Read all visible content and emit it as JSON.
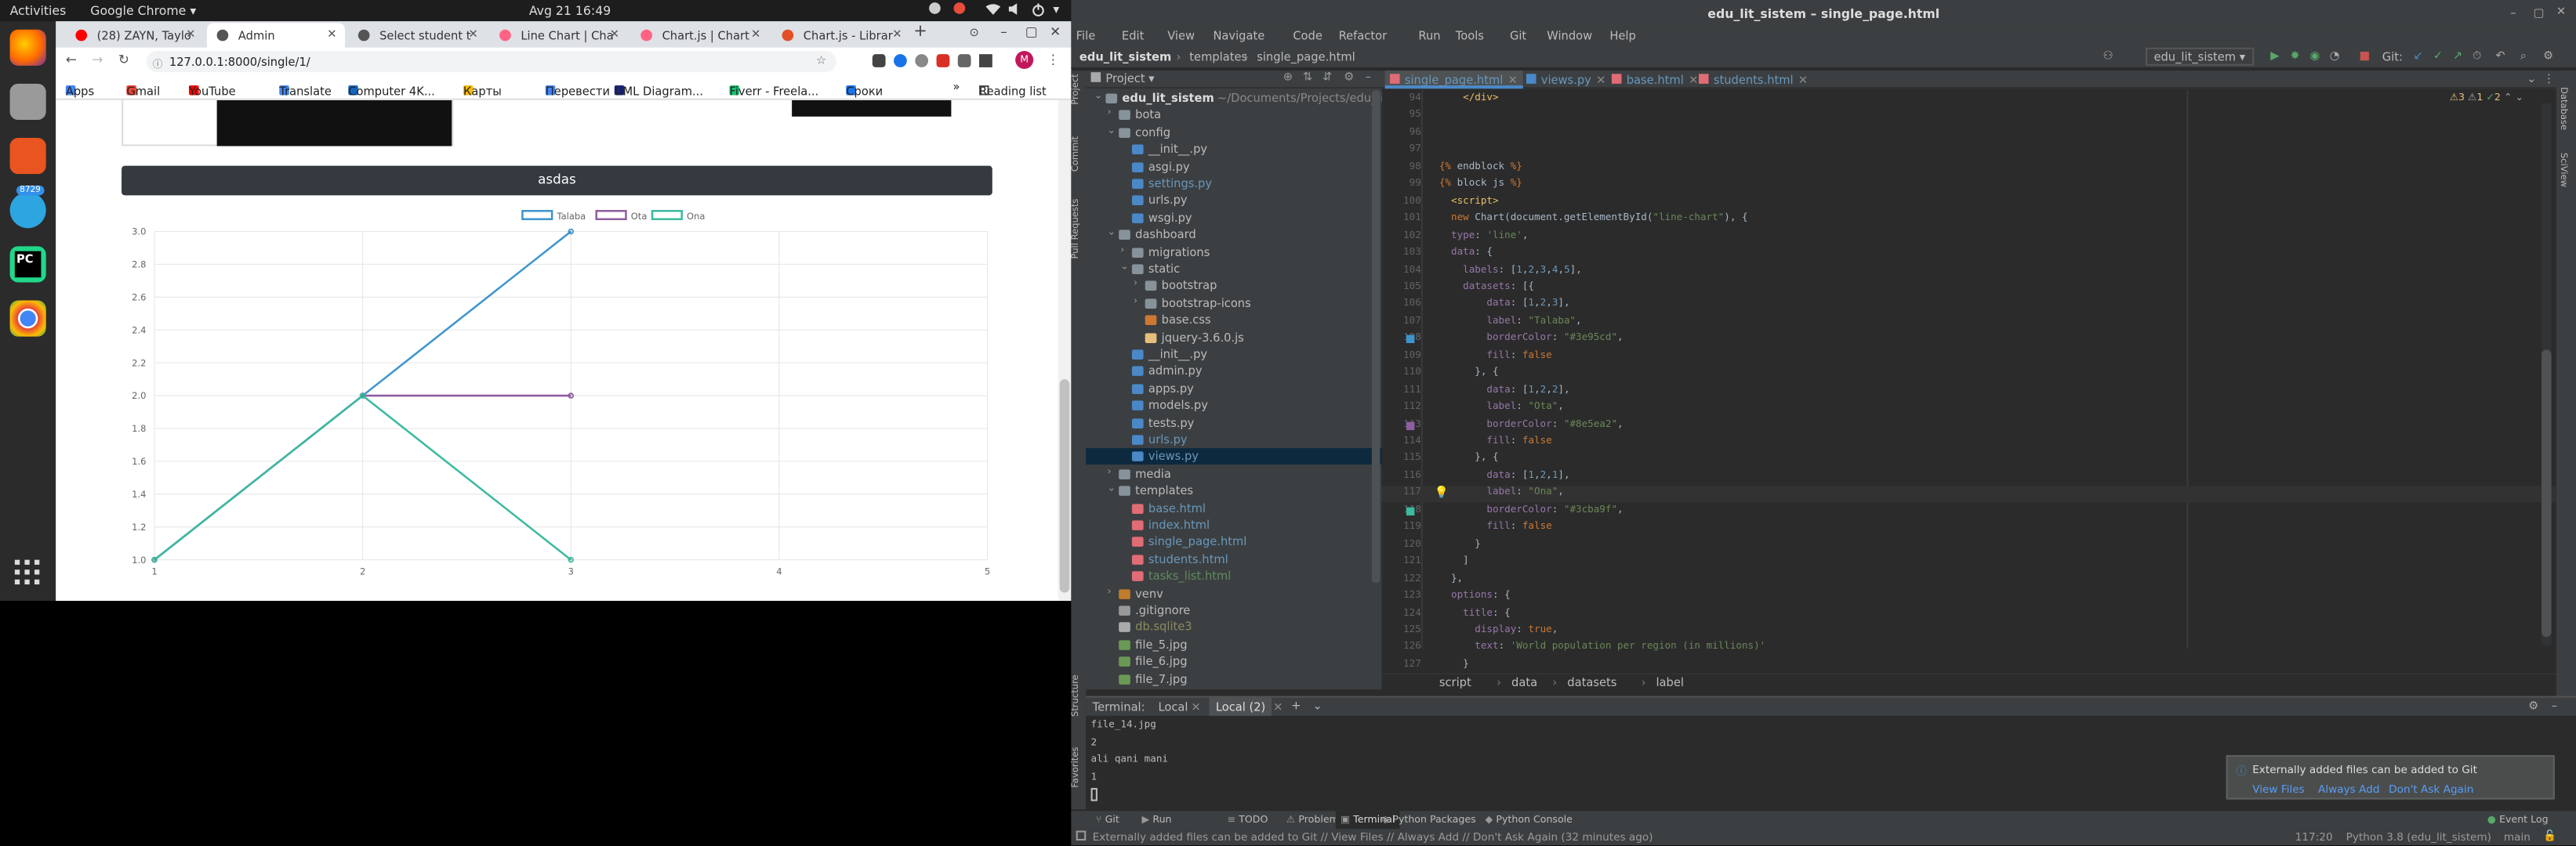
{
  "ubuntu": {
    "activities": "Activities",
    "app_name": "Google Chrome ▾",
    "clock": "Avg 21  16:49",
    "telegram_badge": "8729"
  },
  "chrome": {
    "tabs": [
      {
        "label": "(28) ZAYN, Taylo",
        "color": "#ff0000",
        "active": false
      },
      {
        "label": "Admin",
        "color": "#555555",
        "active": true
      },
      {
        "label": "Select student t",
        "color": "#555555",
        "active": false
      },
      {
        "label": "Line Chart | Cha",
        "color": "#ff6384",
        "active": false
      },
      {
        "label": "Chart.js | Chart",
        "color": "#ff6384",
        "active": false
      },
      {
        "label": "Chart.js - Librar",
        "color": "#e34f26",
        "active": false
      }
    ],
    "new_tab": "+",
    "url": "127.0.0.1:8000/single/1/",
    "profile_initial": "M",
    "bookmarks": [
      "Apps",
      "Gmail",
      "YouTube",
      "Translate",
      "Computer 4K...",
      "Карты",
      "Перевести",
      "UML Diagram...",
      "Fiverr - Freela...",
      "Сроки"
    ],
    "bookmarks_more": "»",
    "reading_list": "Reading list"
  },
  "page": {
    "header_label": "asdas",
    "chart_data": {
      "type": "line",
      "x": [
        1,
        2,
        3,
        4,
        5
      ],
      "ylim": [
        1.0,
        3.0
      ],
      "yticks": [
        "3.0",
        "2.8",
        "2.6",
        "2.4",
        "2.2",
        "2.0",
        "1.8",
        "1.6",
        "1.4",
        "1.2",
        "1.0"
      ],
      "xticks": [
        "1",
        "2",
        "3",
        "4",
        "5"
      ],
      "series": [
        {
          "name": "Talaba",
          "values": [
            1,
            2,
            3
          ],
          "color": "#03e95cd"
        },
        {
          "name": "Ota",
          "values": [
            1,
            2,
            2
          ],
          "color": "#8e5ea2"
        },
        {
          "name": "Ona",
          "values": [
            1,
            2,
            1
          ],
          "color": "#3cba9f"
        }
      ],
      "grid": true,
      "legend": "top"
    }
  },
  "ide": {
    "title": "edu_lit_sistem – single_page.html",
    "menu": [
      "File",
      "Edit",
      "View",
      "Navigate",
      "Code",
      "Refactor",
      "Run",
      "Tools",
      "Git",
      "Window",
      "Help"
    ],
    "breadcrumb": [
      "edu_lit_sistem",
      "templates",
      "single_page.html"
    ],
    "run_config": "edu_lit_sistem ▾",
    "git_label": "Git:",
    "project_label": "Project ▾",
    "editor_tabs": [
      "single_page.html",
      "views.py",
      "base.html",
      "students.html"
    ],
    "tree": [
      {
        "label": "edu_lit_sistem",
        "hint": "~/Documents/Projects/edu_lit",
        "indent": 0,
        "kind": "folder"
      },
      {
        "label": "bota",
        "indent": 1,
        "kind": "folder"
      },
      {
        "label": "config",
        "indent": 1,
        "kind": "folder"
      },
      {
        "label": "__init__.py",
        "indent": 2,
        "kind": "py"
      },
      {
        "label": "asgi.py",
        "indent": 2,
        "kind": "py"
      },
      {
        "label": "settings.py",
        "indent": 2,
        "kind": "pymod"
      },
      {
        "label": "urls.py",
        "indent": 2,
        "kind": "py"
      },
      {
        "label": "wsgi.py",
        "indent": 2,
        "kind": "py"
      },
      {
        "label": "dashboard",
        "indent": 1,
        "kind": "folder"
      },
      {
        "label": "migrations",
        "indent": 2,
        "kind": "folder"
      },
      {
        "label": "static",
        "indent": 2,
        "kind": "folder"
      },
      {
        "label": "bootstrap",
        "indent": 3,
        "kind": "folder"
      },
      {
        "label": "bootstrap-icons",
        "indent": 3,
        "kind": "folder"
      },
      {
        "label": "base.css",
        "indent": 3,
        "kind": "css"
      },
      {
        "label": "jquery-3.6.0.js",
        "indent": 3,
        "kind": "js"
      },
      {
        "label": "__init__.py",
        "indent": 2,
        "kind": "py"
      },
      {
        "label": "admin.py",
        "indent": 2,
        "kind": "py"
      },
      {
        "label": "apps.py",
        "indent": 2,
        "kind": "py"
      },
      {
        "label": "models.py",
        "indent": 2,
        "kind": "py"
      },
      {
        "label": "tests.py",
        "indent": 2,
        "kind": "py"
      },
      {
        "label": "urls.py",
        "indent": 2,
        "kind": "pymod"
      },
      {
        "label": "views.py",
        "indent": 2,
        "kind": "pymod",
        "selected": true
      },
      {
        "label": "media",
        "indent": 1,
        "kind": "folder"
      },
      {
        "label": "templates",
        "indent": 1,
        "kind": "folder"
      },
      {
        "label": "base.html",
        "indent": 2,
        "kind": "html"
      },
      {
        "label": "index.html",
        "indent": 2,
        "kind": "html"
      },
      {
        "label": "single_page.html",
        "indent": 2,
        "kind": "html"
      },
      {
        "label": "students.html",
        "indent": 2,
        "kind": "html"
      },
      {
        "label": "tasks_list.html",
        "indent": 2,
        "kind": "htmlnew"
      },
      {
        "label": "venv",
        "indent": 1,
        "kind": "venv"
      },
      {
        "label": ".gitignore",
        "indent": 1,
        "kind": "text"
      },
      {
        "label": "db.sqlite3",
        "indent": 1,
        "kind": "db"
      },
      {
        "label": "file_5.jpg",
        "indent": 1,
        "kind": "img"
      },
      {
        "label": "file_6.jpg",
        "indent": 1,
        "kind": "img"
      },
      {
        "label": "file_7.jpg",
        "indent": 1,
        "kind": "img"
      }
    ],
    "code": [
      {
        "n": "94",
        "t": "    </div>"
      },
      {
        "n": "95",
        "t": ""
      },
      {
        "n": "96",
        "t": ""
      },
      {
        "n": "97",
        "t": ""
      },
      {
        "n": "98",
        "t": "{% endblock %}"
      },
      {
        "n": "99",
        "t": "{% block js %}"
      },
      {
        "n": "100",
        "t": "  <script>"
      },
      {
        "n": "101",
        "t": "  new Chart(document.getElementById(\"line-chart\"), {"
      },
      {
        "n": "102",
        "t": "  type: 'line',"
      },
      {
        "n": "103",
        "t": "  data: {"
      },
      {
        "n": "104",
        "t": "    labels: [1,2,3,4,5],"
      },
      {
        "n": "105",
        "t": "    datasets: [{"
      },
      {
        "n": "106",
        "t": "        data: [1,2,3],"
      },
      {
        "n": "107",
        "t": "        label: \"Talaba\","
      },
      {
        "n": "108",
        "t": "        borderColor: \"#3e95cd\","
      },
      {
        "n": "109",
        "t": "        fill: false"
      },
      {
        "n": "110",
        "t": "      }, {"
      },
      {
        "n": "111",
        "t": "        data: [1,2,2],"
      },
      {
        "n": "112",
        "t": "        label: \"Ota\","
      },
      {
        "n": "113",
        "t": "        borderColor: \"#8e5ea2\","
      },
      {
        "n": "114",
        "t": "        fill: false"
      },
      {
        "n": "115",
        "t": "      }, {"
      },
      {
        "n": "116",
        "t": "        data: [1,2,1],"
      },
      {
        "n": "117",
        "t": "        label: \"Ona\","
      },
      {
        "n": "118",
        "t": "        borderColor: \"#3cba9f\","
      },
      {
        "n": "119",
        "t": "        fill: false"
      },
      {
        "n": "120",
        "t": "      }"
      },
      {
        "n": "121",
        "t": "    ]"
      },
      {
        "n": "122",
        "t": "  },"
      },
      {
        "n": "123",
        "t": "  options: {"
      },
      {
        "n": "124",
        "t": "    title: {"
      },
      {
        "n": "125",
        "t": "      display: true,"
      },
      {
        "n": "126",
        "t": "      text: 'World population per region (in millions)'"
      },
      {
        "n": "127",
        "t": "    }"
      }
    ],
    "code_breadcrumb": [
      "script",
      "data",
      "datasets",
      "label"
    ],
    "inspections": {
      "warn": "3",
      "weak": "1",
      "typo": "2"
    },
    "terminal": {
      "label": "Terminal:",
      "tabs": [
        "Local",
        "Local (2)"
      ],
      "lines": [
        "file_14.jpg",
        "2",
        "ali qani mani",
        "1",
        ""
      ]
    },
    "bottom_tools": [
      "Git",
      "Run",
      "TODO",
      "Problems",
      "Terminal",
      "Python Packages",
      "Python Console"
    ],
    "event_log": "Event Log",
    "notification": {
      "text": "Externally added files can be added to Git",
      "actions": [
        "View Files",
        "Always Add",
        "Don't Ask Again"
      ]
    },
    "status": {
      "message": "Externally added files can be added to Git // View Files // Always Add // Don't Ask Again (32 minutes ago)",
      "position": "117:20",
      "interpreter": "Python 3.8 (edu_lit_sistem)",
      "branch": "main"
    },
    "side_tools_left": [
      "Project",
      "Commit",
      "Pull Requests",
      "Structure",
      "Favorites"
    ],
    "side_tools_right": [
      "Database",
      "SciView"
    ]
  }
}
